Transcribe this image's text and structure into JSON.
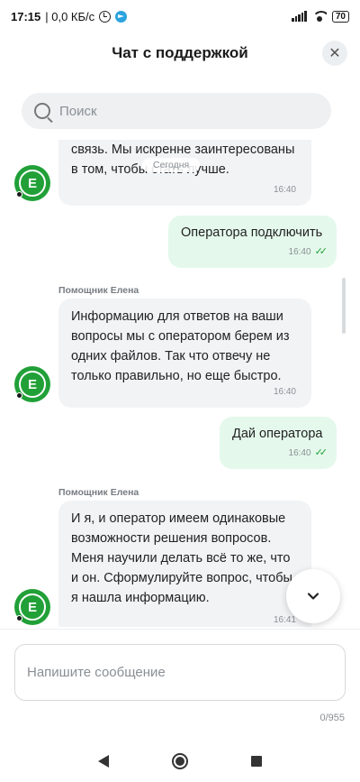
{
  "status_bar": {
    "time": "17:15",
    "network_speed": "| 0,0 КБ/с",
    "battery": "70"
  },
  "header": {
    "title": "Чат с поддержкой",
    "close_icon": "✕"
  },
  "search": {
    "placeholder": "Поиск"
  },
  "chat": {
    "date_chip": "Сегодня",
    "messages": [
      {
        "direction": "in",
        "text": "связь. Мы искренне заинтересованы в том, чтобы стать лучше.",
        "time": "16:40",
        "avatar_letter": "Е"
      },
      {
        "direction": "out",
        "text": "Оператора подключить",
        "time": "16:40",
        "status": "read"
      },
      {
        "direction": "in",
        "sender": "Помощник Елена",
        "text": "Информацию для ответов на ваши вопросы мы с оператором берем из одних файлов. Так что отвечу не только правильно, но еще быстро.",
        "time": "16:40",
        "avatar_letter": "Е"
      },
      {
        "direction": "out",
        "text": "Дай оператора",
        "time": "16:40",
        "status": "read"
      },
      {
        "direction": "in",
        "sender": "Помощник Елена",
        "text": "И я, и оператор имеем одинаковые возможности решения вопросов. Меня научили делать всё то же, что и он. Сформулируйте вопрос, чтобы я нашла информацию.",
        "time": "16:41",
        "avatar_letter": "Е"
      }
    ]
  },
  "composer": {
    "placeholder": "Напишите сообщение",
    "counter": "0/955"
  },
  "colors": {
    "accent": "#21a038",
    "incoming_bubble": "#f2f3f5",
    "outgoing_bubble": "#e4f9ec"
  }
}
